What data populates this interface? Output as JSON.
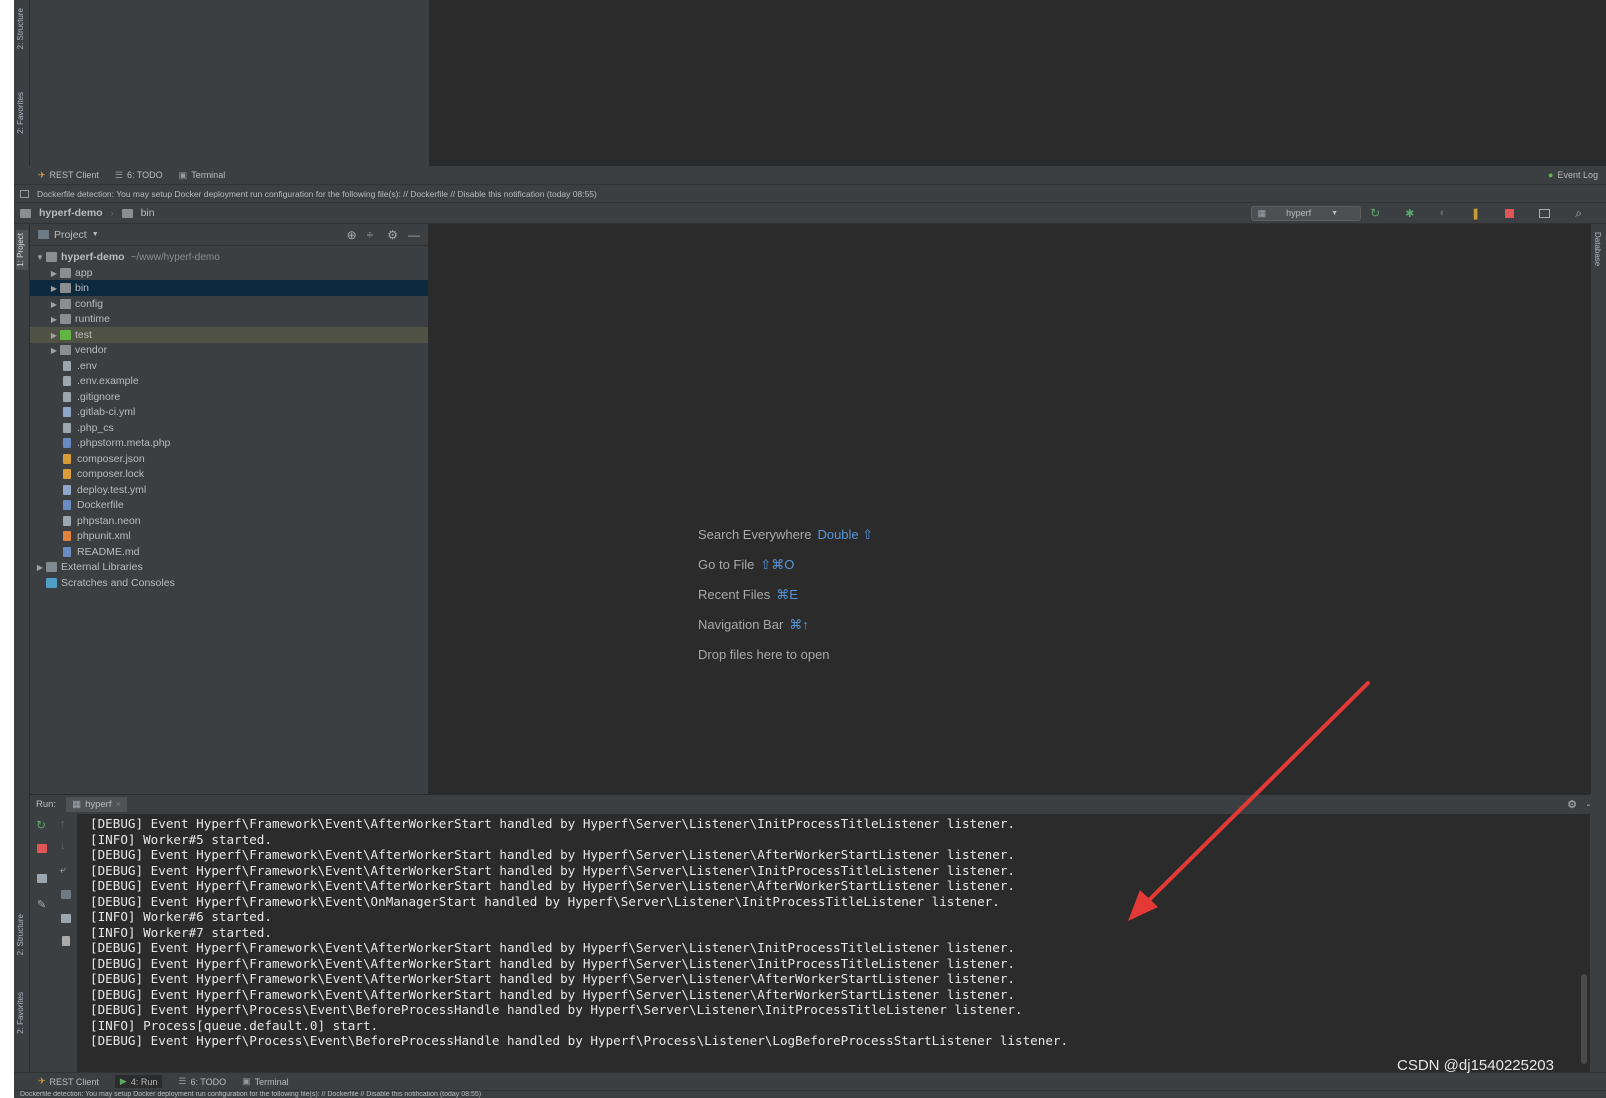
{
  "top_bottom_bar": {
    "tabs": [
      "REST Client",
      "6: TODO",
      "Terminal"
    ],
    "event_log": "Event Log"
  },
  "notification": {
    "text": "Dockerfile detection: You may setup Docker deployment run configuration for the following file(s): // Dockerfile // Disable this notification (today 08:55)"
  },
  "breadcrumb": {
    "project": "hyperf-demo",
    "folder": "bin"
  },
  "run_config": {
    "label": "hyperf"
  },
  "side_tabs": {
    "structure": "2: Structure",
    "favorites": "2: Favorites",
    "project": "1: Project",
    "database": "Database"
  },
  "project_panel": {
    "title": "Project",
    "root": {
      "name": "hyperf-demo",
      "path": "~/www/hyperf-demo"
    },
    "items": [
      {
        "name": "app",
        "type": "folder"
      },
      {
        "name": "bin",
        "type": "folder"
      },
      {
        "name": "config",
        "type": "folder"
      },
      {
        "name": "runtime",
        "type": "folder"
      },
      {
        "name": "test",
        "type": "folder"
      },
      {
        "name": "vendor",
        "type": "folder"
      },
      {
        "name": ".env",
        "type": "file"
      },
      {
        "name": ".env.example",
        "type": "file"
      },
      {
        "name": ".gitignore",
        "type": "file"
      },
      {
        "name": ".gitlab-ci.yml",
        "type": "yml"
      },
      {
        "name": ".php_cs",
        "type": "file"
      },
      {
        "name": ".phpstorm.meta.php",
        "type": "php"
      },
      {
        "name": "composer.json",
        "type": "json"
      },
      {
        "name": "composer.lock",
        "type": "json"
      },
      {
        "name": "deploy.test.yml",
        "type": "yml"
      },
      {
        "name": "Dockerfile",
        "type": "php"
      },
      {
        "name": "phpstan.neon",
        "type": "file"
      },
      {
        "name": "phpunit.xml",
        "type": "xml"
      },
      {
        "name": "README.md",
        "type": "php"
      }
    ],
    "external": "External Libraries",
    "scratches": "Scratches and Consoles"
  },
  "editor_hints": [
    {
      "label": "Search Everywhere",
      "shortcut": "Double ⇧"
    },
    {
      "label": "Go to File",
      "shortcut": "⇧⌘O"
    },
    {
      "label": "Recent Files",
      "shortcut": "⌘E"
    },
    {
      "label": "Navigation Bar",
      "shortcut": "⌘↑"
    },
    {
      "label": "Drop files here to open",
      "shortcut": ""
    }
  ],
  "run_panel": {
    "label": "Run:",
    "tab": "hyperf",
    "lines": [
      "[DEBUG] Event Hyperf\\Framework\\Event\\AfterWorkerStart handled by Hyperf\\Server\\Listener\\InitProcessTitleListener listener.",
      "[INFO] Worker#5 started.",
      "[DEBUG] Event Hyperf\\Framework\\Event\\AfterWorkerStart handled by Hyperf\\Server\\Listener\\AfterWorkerStartListener listener.",
      "[DEBUG] Event Hyperf\\Framework\\Event\\AfterWorkerStart handled by Hyperf\\Server\\Listener\\InitProcessTitleListener listener.",
      "[DEBUG] Event Hyperf\\Framework\\Event\\AfterWorkerStart handled by Hyperf\\Server\\Listener\\AfterWorkerStartListener listener.",
      "[DEBUG] Event Hyperf\\Framework\\Event\\OnManagerStart handled by Hyperf\\Server\\Listener\\InitProcessTitleListener listener.",
      "[INFO] Worker#6 started.",
      "[INFO] Worker#7 started.",
      "[DEBUG] Event Hyperf\\Framework\\Event\\AfterWorkerStart handled by Hyperf\\Server\\Listener\\InitProcessTitleListener listener.",
      "[DEBUG] Event Hyperf\\Framework\\Event\\AfterWorkerStart handled by Hyperf\\Server\\Listener\\InitProcessTitleListener listener.",
      "[DEBUG] Event Hyperf\\Framework\\Event\\AfterWorkerStart handled by Hyperf\\Server\\Listener\\AfterWorkerStartListener listener.",
      "[DEBUG] Event Hyperf\\Framework\\Event\\AfterWorkerStart handled by Hyperf\\Server\\Listener\\AfterWorkerStartListener listener.",
      "[DEBUG] Event Hyperf\\Process\\Event\\BeforeProcessHandle handled by Hyperf\\Server\\Listener\\InitProcessTitleListener listener.",
      "[INFO] Process[queue.default.0] start.",
      "[DEBUG] Event Hyperf\\Process\\Event\\BeforeProcessHandle handled by Hyperf\\Process\\Listener\\LogBeforeProcessStartListener listener."
    ]
  },
  "bottom_bar": {
    "tabs": [
      "REST Client",
      "4: Run",
      "6: TODO",
      "Terminal"
    ]
  },
  "watermark": "CSDN @dj1540225203",
  "colors": {
    "arrow": "#e53935",
    "selection": "#0d293e",
    "link": "#5895d7"
  }
}
